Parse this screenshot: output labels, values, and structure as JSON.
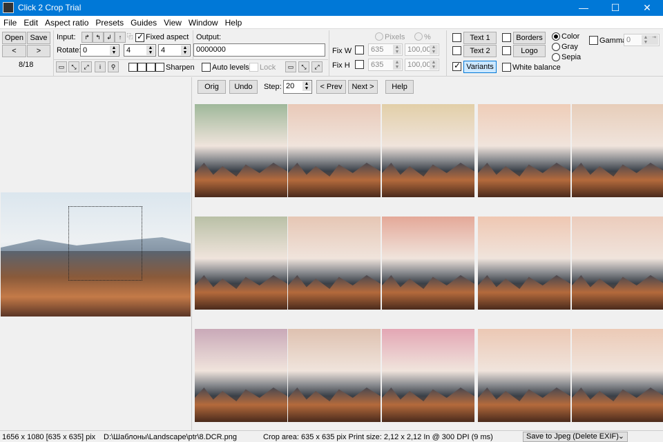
{
  "window": {
    "title": "Click 2 Crop Trial",
    "minimize": "—",
    "maximize": "☐",
    "close": "✕"
  },
  "menu": [
    "File",
    "Edit",
    "Aspect ratio",
    "Presets",
    "Guides",
    "View",
    "Window",
    "Help"
  ],
  "toolbar": {
    "open": "Open",
    "save": "Save",
    "prev": "<",
    "next": ">",
    "counter": "8/18",
    "input_label": "Input:",
    "rotate_label": "Rotate:",
    "rotate_value": "0",
    "ratio_w": "4",
    "ratio_h": "4",
    "fixed_aspect": "Fixed aspect",
    "fixed_aspect_checked": true,
    "output_label": "Output:",
    "output_value": "0000000",
    "sharpen": "Sharpen",
    "auto_levels": "Auto levels",
    "lock": "Lock",
    "pixels": "Pixels",
    "percent": "%",
    "fix_w": "Fix W",
    "fix_h": "Fix H",
    "fix_w_px": "635",
    "fix_w_pct": "100,00",
    "fix_h_px": "635",
    "fix_h_pct": "100,00",
    "text1": "Text 1",
    "text2": "Text 2",
    "borders": "Borders",
    "logo": "Logo",
    "variants": "Variants",
    "variants_checked": true,
    "white_balance": "White balance",
    "color": "Color",
    "gray": "Gray",
    "sepia": "Sepia",
    "color_mode": "Color",
    "gamma": "Gamma",
    "gamma_value": "0"
  },
  "variants_bar": {
    "orig": "Orig",
    "undo": "Undo",
    "step_label": "Step:",
    "step_value": "20",
    "prev": "< Prev",
    "next": "Next >",
    "help": "Help"
  },
  "thumb_tints": [
    [
      "#9fb89a",
      "#e9c9b8",
      "#e2cfa8",
      "#efcdb8",
      "#e7cdb9"
    ],
    [
      "#b9c0a6",
      "#e6c6b4",
      "#e4a898",
      "#efc7b2",
      "#ecccbc"
    ],
    [
      "#c9a9b8",
      "#dec1b0",
      "#e3a6b4",
      "#ecc8b4",
      "#eccab6"
    ]
  ],
  "status": {
    "dims": "1656 x 1080  [635 x 635] pix",
    "path": "D:\\Шаблоны\\Landscape\\ptr\\8.DCR.png",
    "crop": "Crop area: 635 x 635 pix  Print size: 2,12 x 2,12 In @ 300 DPI  (9 ms)",
    "save_mode": "Save to Jpeg (Delete EXIF)"
  }
}
